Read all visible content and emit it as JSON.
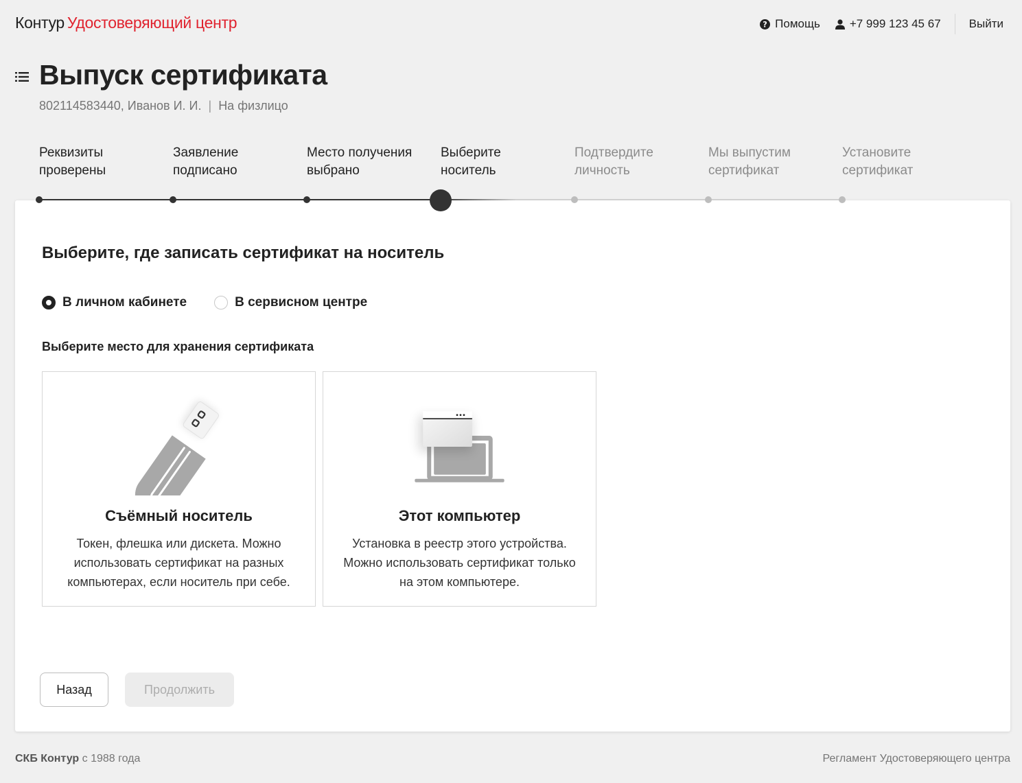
{
  "header": {
    "brand": "Контур",
    "product": "Удостоверяющий центр",
    "help_label": "Помощь",
    "phone": "+7 999 123 45 67",
    "logout_label": "Выйти"
  },
  "page": {
    "title": "Выпуск сертификата",
    "subtitle_id": "802114583440, Иванов И. И.",
    "subtitle_sep": "|",
    "subtitle_type": "На физлицо"
  },
  "steps": [
    {
      "line1": "Реквизиты",
      "line2": "проверены",
      "state": "done"
    },
    {
      "line1": "Заявление",
      "line2": "подписано",
      "state": "done"
    },
    {
      "line1": "Место получения",
      "line2": "выбрано",
      "state": "done"
    },
    {
      "line1": "Выберите",
      "line2": "носитель",
      "state": "current"
    },
    {
      "line1": "Подтвердите",
      "line2": "личность",
      "state": "future"
    },
    {
      "line1": "Мы выпустим",
      "line2": "сертификат",
      "state": "future"
    },
    {
      "line1": "Установите",
      "line2": "сертификат",
      "state": "future"
    }
  ],
  "card": {
    "title": "Выберите, где записать сертификат на носитель",
    "radio_options": [
      {
        "label": "В личном кабинете",
        "checked": true
      },
      {
        "label": "В сервисном центре",
        "checked": false
      }
    ],
    "storage_label": "Выберите место для хранения сертификата",
    "tiles": [
      {
        "icon": "usb-drive-icon",
        "title": "Съёмный носитель",
        "description": "Токен, флешка или дискета. Можно использовать сертификат на разных компьютерах, если носитель при себе."
      },
      {
        "icon": "laptop-icon",
        "title": "Этот компьютер",
        "description": "Установка в реестр этого устройства. Можно использовать сертификат только на этом компьютере."
      }
    ],
    "back_label": "Назад",
    "continue_label": "Продолжить"
  },
  "footer": {
    "company": "СКБ Контур",
    "since": " с 1988 года",
    "regulation_link": "Регламент Удостоверяющего центра"
  },
  "colors": {
    "accent_red": "#e0232f",
    "dark": "#333333",
    "background": "#f0f0f0"
  }
}
